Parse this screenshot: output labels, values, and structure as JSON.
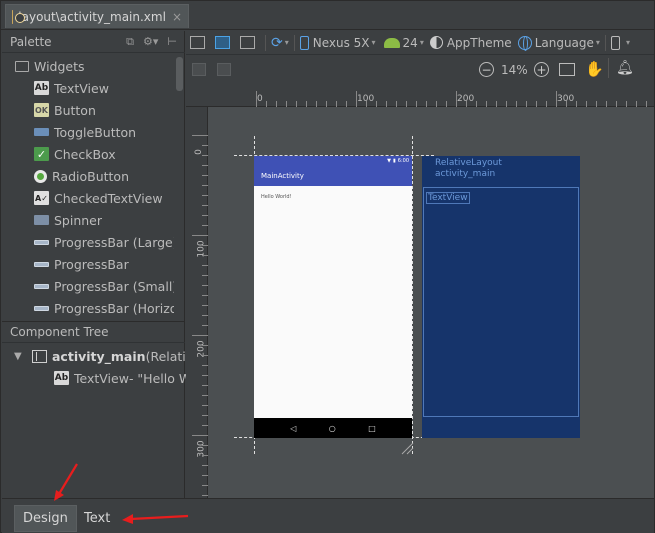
{
  "file_tab": {
    "label": "layout\\activity_main.xml",
    "close": "×"
  },
  "palette": {
    "title": "Palette",
    "items": [
      {
        "label": "Widgets",
        "type": "group",
        "icon": "folder-icon"
      },
      {
        "label": "TextView",
        "type": "item",
        "icon": "textview-icon",
        "glyph": "Ab"
      },
      {
        "label": "Button",
        "type": "item",
        "icon": "button-icon",
        "glyph": "OK"
      },
      {
        "label": "ToggleButton",
        "type": "item",
        "icon": "toggle-button-icon",
        "glyph": ""
      },
      {
        "label": "CheckBox",
        "type": "item",
        "icon": "checkbox-icon",
        "glyph": "✓"
      },
      {
        "label": "RadioButton",
        "type": "item",
        "icon": "radio-button-icon",
        "glyph": ""
      },
      {
        "label": "CheckedTextView",
        "type": "item",
        "icon": "checked-textview-icon",
        "glyph": "A✓"
      },
      {
        "label": "Spinner",
        "type": "item",
        "icon": "spinner-icon",
        "glyph": ""
      },
      {
        "label": "ProgressBar (Large)",
        "type": "item",
        "icon": "progressbar-icon",
        "glyph": ""
      },
      {
        "label": "ProgressBar",
        "type": "item",
        "icon": "progressbar-icon",
        "glyph": ""
      },
      {
        "label": "ProgressBar (Small)",
        "type": "item",
        "icon": "progressbar-icon",
        "glyph": ""
      },
      {
        "label": "ProgressBar (Horizont",
        "type": "item",
        "icon": "progressbar-icon",
        "glyph": ""
      }
    ]
  },
  "component_tree": {
    "title": "Component Tree",
    "root": {
      "label": "activity_main",
      "suffix": " (Relative"
    },
    "child": {
      "label": "TextView",
      "suffix": " - \"Hello W"
    }
  },
  "toolbar": {
    "device": "Nexus 5X",
    "api": "24",
    "theme": "AppTheme",
    "language": "Language",
    "zoom": "14%"
  },
  "ruler": {
    "top": [
      "0",
      "100",
      "200",
      "300"
    ],
    "left": [
      "0",
      "100",
      "200",
      "300"
    ]
  },
  "device_preview": {
    "status_time": "6:00",
    "app_title": "MainActivity",
    "hello_text": "Hello World!",
    "nav_back": "◁",
    "nav_home": "○",
    "nav_recent": "□"
  },
  "blueprint": {
    "layout_name": "RelativeLayout",
    "layout_id": "activity_main",
    "textview": "TextView"
  },
  "bottom_tabs": {
    "design": "Design",
    "text": "Text"
  },
  "colors": {
    "accent_red": "#e81d1d",
    "app_bar": "#3f51b5",
    "blueprint": "#16346b"
  }
}
